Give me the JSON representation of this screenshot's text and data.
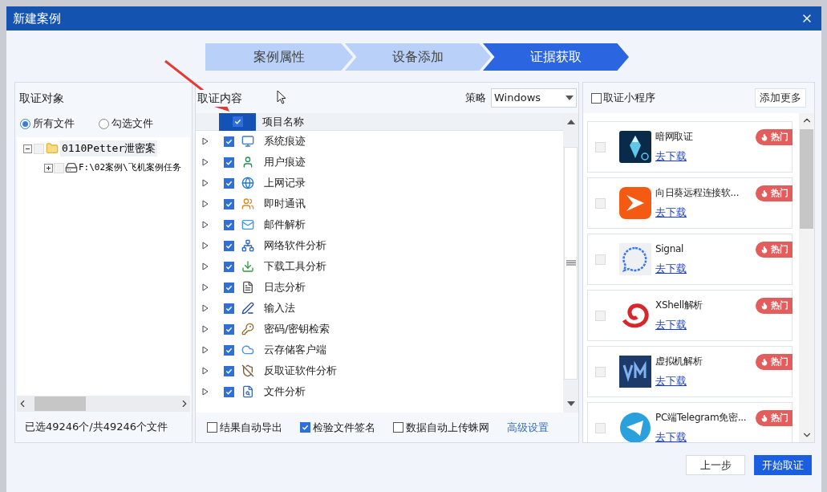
{
  "window": {
    "title": "新建案例"
  },
  "steps": [
    {
      "label": "案例属性",
      "selected": false
    },
    {
      "label": "设备添加",
      "selected": false
    },
    {
      "label": "证据获取",
      "selected": true
    }
  ],
  "left_panel": {
    "title": "取证对象",
    "radios": [
      {
        "label": "所有文件",
        "selected": true
      },
      {
        "label": "勾选文件",
        "selected": false
      }
    ],
    "tree": [
      {
        "label": "0110Petter泄密案",
        "expanded": true,
        "checked": false,
        "children": [
          {
            "label": "F:\\02案例\\飞机案例任务",
            "expanded": false,
            "checked": false
          }
        ]
      }
    ],
    "footer": "已选49246个/共49246个文件"
  },
  "middle_panel": {
    "title": "取证内容",
    "strategy_label": "策略",
    "strategy_value": "Windows",
    "header": {
      "label": "项目名称",
      "checked": true
    },
    "items": [
      {
        "label": "系统痕迹",
        "checked": true
      },
      {
        "label": "用户痕迹",
        "checked": true
      },
      {
        "label": "上网记录",
        "checked": true
      },
      {
        "label": "即时通讯",
        "checked": true
      },
      {
        "label": "邮件解析",
        "checked": true
      },
      {
        "label": "网络软件分析",
        "checked": true
      },
      {
        "label": "下载工具分析",
        "checked": true
      },
      {
        "label": "日志分析",
        "checked": true
      },
      {
        "label": "输入法",
        "checked": true
      },
      {
        "label": "密码/密钥检索",
        "checked": true
      },
      {
        "label": "云存储客户端",
        "checked": true
      },
      {
        "label": "反取证软件分析",
        "checked": true
      },
      {
        "label": "文件分析",
        "checked": true
      }
    ],
    "options": [
      {
        "label": "结果自动导出",
        "checked": false
      },
      {
        "label": "检验文件签名",
        "checked": true
      },
      {
        "label": "数据自动上传蛛网",
        "checked": false
      }
    ],
    "link": "高级设置"
  },
  "right_panel": {
    "title": "取证小程序",
    "checked": false,
    "add_button": "添加更多",
    "apps": [
      {
        "name": "暗网取证",
        "link": "去下载",
        "badge": "热门",
        "checked": false
      },
      {
        "name": "向日葵远程连接软...",
        "link": "去下载",
        "badge": "热门",
        "checked": false
      },
      {
        "name": "Signal",
        "link": "去下载",
        "badge": "热门",
        "checked": false
      },
      {
        "name": "XShell解析",
        "link": "去下载",
        "badge": "热门",
        "checked": false
      },
      {
        "name": "虚拟机解析",
        "link": "去下载",
        "badge": "热门",
        "checked": false
      },
      {
        "name": "PC端Telegram免密...",
        "link": "去下载",
        "badge": "热门",
        "checked": false
      }
    ]
  },
  "buttons": [
    {
      "label": "上一步",
      "kind": "secondary"
    },
    {
      "label": "开始取证",
      "kind": "primary"
    }
  ]
}
